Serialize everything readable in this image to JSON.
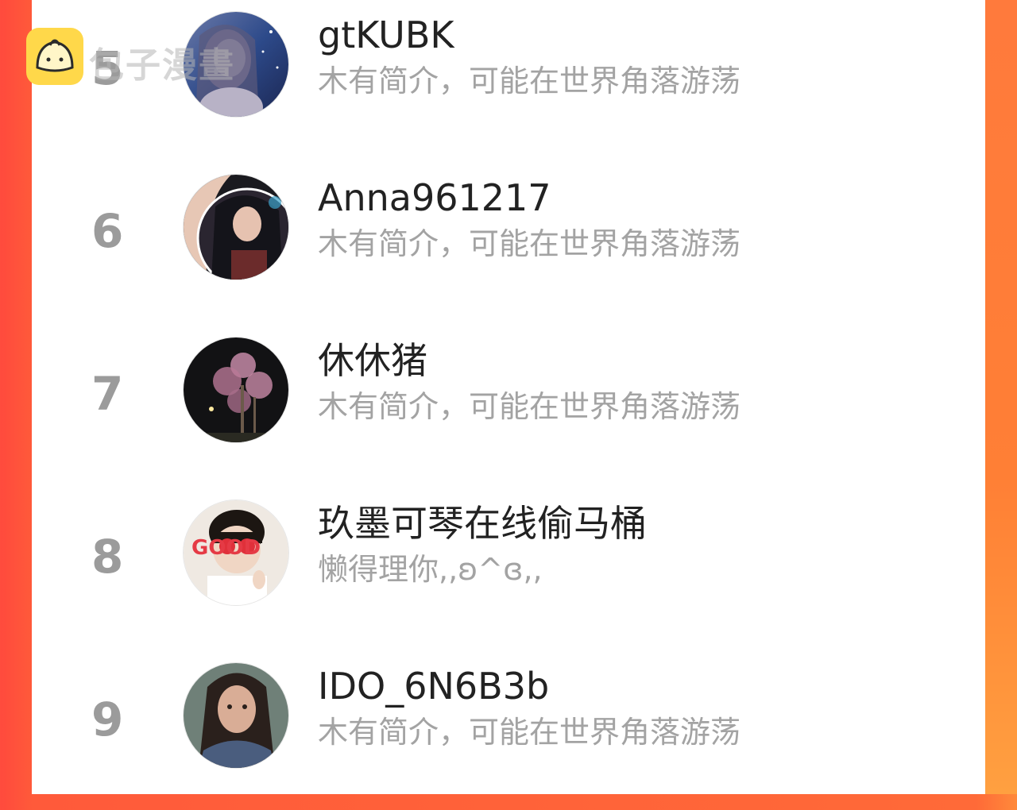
{
  "watermark": {
    "text": "包子漫畫"
  },
  "rows": [
    {
      "rank": "5",
      "name": "gtKUBK",
      "bio": "木有简介，可能在世界角落游荡"
    },
    {
      "rank": "6",
      "name": "Anna961217",
      "bio": "木有简介，可能在世界角落游荡"
    },
    {
      "rank": "7",
      "name": "休休猪",
      "bio": "木有简介，可能在世界角落游荡"
    },
    {
      "rank": "8",
      "name": "玖墨可琴在线偷马桶",
      "bio": "懒得理你,,ʚ^ɞ,,"
    },
    {
      "rank": "9",
      "name": "IDO_6N6B3b",
      "bio": "木有简介，可能在世界角落游荡"
    }
  ],
  "avatar_8_text": "GOOD"
}
